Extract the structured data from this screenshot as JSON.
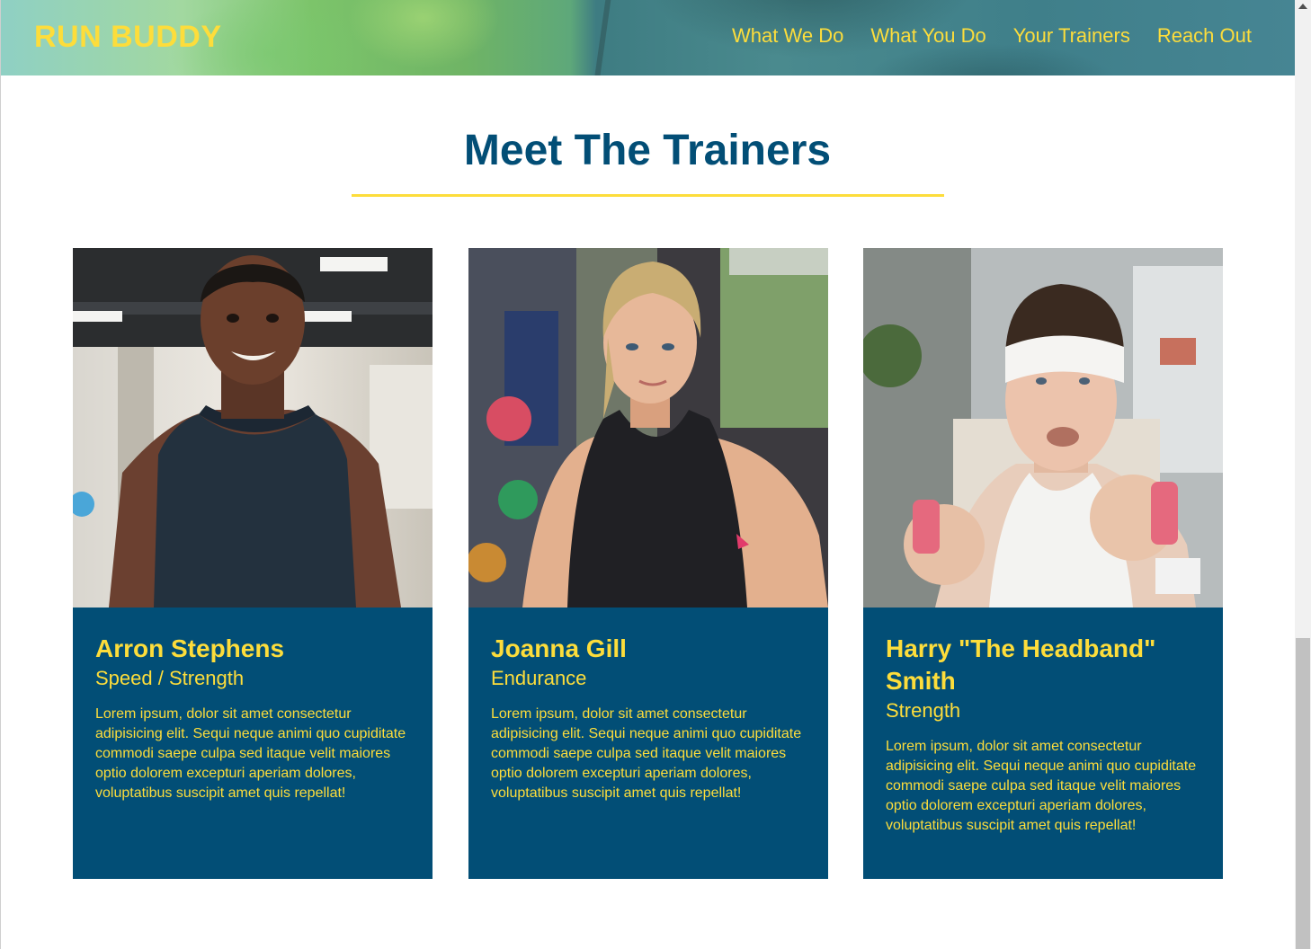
{
  "header": {
    "logo": "RUN BUDDY",
    "nav": [
      "What We Do",
      "What You Do",
      "Your Trainers",
      "Reach Out"
    ]
  },
  "section": {
    "title": "Meet The Trainers"
  },
  "trainers": [
    {
      "name": "Arron Stephens",
      "role": "Speed / Strength",
      "bio": "Lorem ipsum, dolor sit amet consectetur adipisicing elit. Sequi neque animi quo cupiditate commodi saepe culpa sed itaque velit maiores optio dolorem excepturi aperiam dolores, voluptatibus suscipit amet quis repellat!"
    },
    {
      "name": "Joanna Gill",
      "role": "Endurance",
      "bio": "Lorem ipsum, dolor sit amet consectetur adipisicing elit. Sequi neque animi quo cupiditate commodi saepe culpa sed itaque velit maiores optio dolorem excepturi aperiam dolores, voluptatibus suscipit amet quis repellat!"
    },
    {
      "name": "Harry \"The Headband\" Smith",
      "role": "Strength",
      "bio": "Lorem ipsum, dolor sit amet consectetur adipisicing elit. Sequi neque animi quo cupiditate commodi saepe culpa sed itaque velit maiores optio dolorem excepturi aperiam dolores, voluptatibus suscipit amet quis repellat!"
    }
  ],
  "colors": {
    "primary": "#024e76",
    "accent": "#fddd3b"
  }
}
